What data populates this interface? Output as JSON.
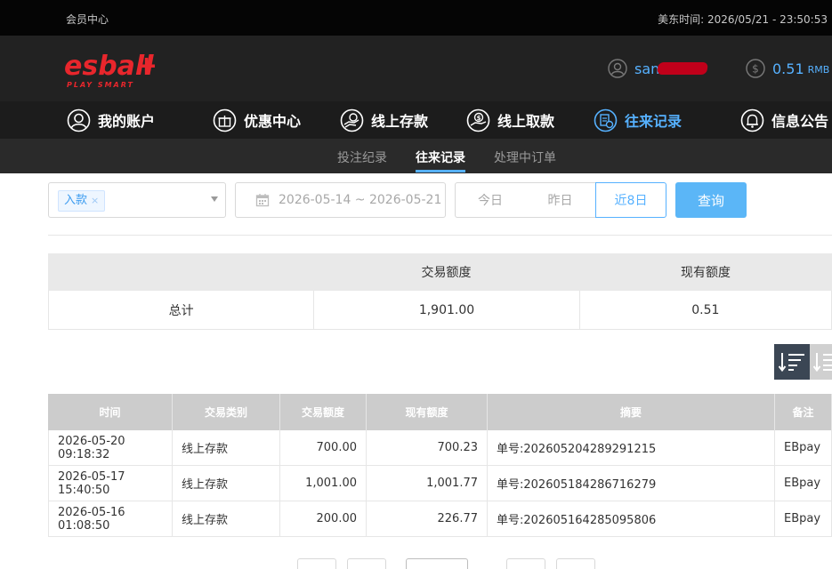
{
  "topbar": {
    "left_label": "会员中心",
    "time_label": "美东时间:",
    "time_value": "2026/05/21 - 23:50:53"
  },
  "header": {
    "logo_text": "esball+",
    "logo_tagline": "PLAY SMART",
    "username_prefix": "san",
    "balance_amount": "0.51",
    "balance_currency": "RMB"
  },
  "mainnav": {
    "items": [
      {
        "label": "我的账户",
        "icon": "user-icon"
      },
      {
        "label": "优惠中心",
        "icon": "gift-icon"
      },
      {
        "label": "线上存款",
        "icon": "deposit-icon"
      },
      {
        "label": "线上取款",
        "icon": "withdraw-icon"
      },
      {
        "label": "往来记录",
        "icon": "records-icon",
        "active": true
      },
      {
        "label": "信息公告",
        "icon": "bell-icon"
      }
    ]
  },
  "subnav": {
    "items": [
      {
        "label": "投注纪录"
      },
      {
        "label": "往来记录",
        "active": true
      },
      {
        "label": "处理中订单"
      }
    ]
  },
  "filters": {
    "type_tag": "入款",
    "tag_remove": "×",
    "date_range": "2026-05-14 ~ 2026-05-21",
    "quick_today": "今日",
    "quick_yesterday": "昨日",
    "quick_8days": "近8日",
    "query_button": "查询"
  },
  "summary": {
    "headers": [
      "",
      "交易额度",
      "现有额度"
    ],
    "row": {
      "label": "总计",
      "amount": "1,901.00",
      "balance": "0.51"
    }
  },
  "table": {
    "headers": [
      "时间",
      "交易类别",
      "交易额度",
      "现有额度",
      "摘要",
      "备注"
    ],
    "rows": [
      {
        "time": "2026-05-20 09:18:32",
        "type": "线上存款",
        "amount": "700.00",
        "balance": "700.23",
        "summary": "单号:202605204289291215",
        "note": "EBpay"
      },
      {
        "time": "2026-05-17 15:40:50",
        "type": "线上存款",
        "amount": "1,001.00",
        "balance": "1,001.77",
        "summary": "单号:202605184286716279",
        "note": "EBpay"
      },
      {
        "time": "2026-05-16 01:08:50",
        "type": "线上存款",
        "amount": "200.00",
        "balance": "226.77",
        "summary": "单号:202605164285095806",
        "note": "EBpay"
      }
    ]
  },
  "colors": {
    "accent": "#56b1ff",
    "brand_red": "#e8262c",
    "query_button": "#5bb6f7"
  }
}
